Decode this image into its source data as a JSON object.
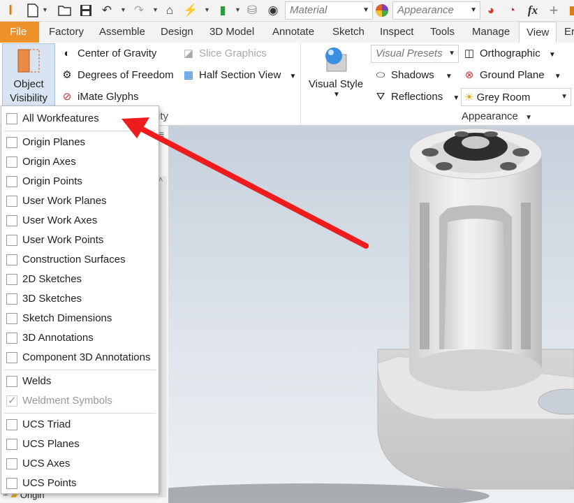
{
  "quick_access": {
    "material_placeholder": "Material",
    "appearance_placeholder": "Appearance",
    "fx_label": "fx",
    "plus_label": "+"
  },
  "tabs": [
    {
      "label": "File"
    },
    {
      "label": "Factory"
    },
    {
      "label": "Assemble"
    },
    {
      "label": "Design"
    },
    {
      "label": "3D Model"
    },
    {
      "label": "Annotate"
    },
    {
      "label": "Sketch"
    },
    {
      "label": "Inspect"
    },
    {
      "label": "Tools"
    },
    {
      "label": "Manage"
    },
    {
      "label": "View"
    },
    {
      "label": "Er"
    }
  ],
  "ribbon": {
    "object_visibility": {
      "line1": "Object",
      "line2": "Visibility"
    },
    "center_of_gravity": "Center of Gravity",
    "degrees_of_freedom": "Degrees of Freedom",
    "imate_glyphs": "iMate Glyphs",
    "slice_graphics": "Slice Graphics",
    "half_section_view": "Half Section View",
    "panel_label_partial": "ity",
    "visual_style": "Visual Style",
    "visual_presets": "Visual Presets",
    "shadows": "Shadows",
    "reflections": "Reflections",
    "orthographic": "Orthographic",
    "ground_plane": "Ground Plane",
    "grey_room": "Grey Room",
    "appearance_panel": "Appearance"
  },
  "menu": {
    "items": [
      {
        "label": "All Workfeatures",
        "checked": false,
        "disabled": false
      },
      {
        "label": "Origin Planes",
        "checked": false,
        "disabled": false
      },
      {
        "label": "Origin Axes",
        "checked": false,
        "disabled": false
      },
      {
        "label": "Origin Points",
        "checked": false,
        "disabled": false
      },
      {
        "label": "User Work Planes",
        "checked": false,
        "disabled": false
      },
      {
        "label": "User Work Axes",
        "checked": false,
        "disabled": false
      },
      {
        "label": "User Work Points",
        "checked": false,
        "disabled": false
      },
      {
        "label": "Construction Surfaces",
        "checked": false,
        "disabled": false
      },
      {
        "label": "2D Sketches",
        "checked": false,
        "disabled": false
      },
      {
        "label": "3D Sketches",
        "checked": false,
        "disabled": false
      },
      {
        "label": "Sketch Dimensions",
        "checked": false,
        "disabled": false
      },
      {
        "label": "3D Annotations",
        "checked": false,
        "disabled": false
      },
      {
        "label": "Component 3D Annotations",
        "checked": false,
        "disabled": false
      },
      {
        "label": "Welds",
        "checked": false,
        "disabled": false
      },
      {
        "label": "Weldment Symbols",
        "checked": true,
        "disabled": true
      },
      {
        "label": "UCS Triad",
        "checked": false,
        "disabled": false
      },
      {
        "label": "UCS Planes",
        "checked": false,
        "disabled": false
      },
      {
        "label": "UCS Axes",
        "checked": false,
        "disabled": false
      },
      {
        "label": "UCS Points",
        "checked": false,
        "disabled": false
      }
    ]
  },
  "browser": {
    "origin_label": "Origin"
  },
  "colors": {
    "file_tab": "#ee9128",
    "arrow": "#ee1c1c",
    "accent": "#2d7bd5"
  }
}
